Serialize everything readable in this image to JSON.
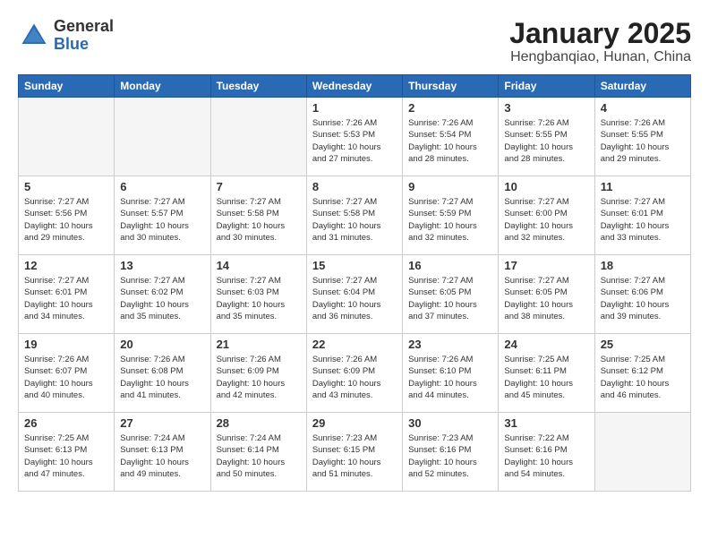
{
  "header": {
    "logo_general": "General",
    "logo_blue": "Blue",
    "title": "January 2025",
    "subtitle": "Hengbanqiao, Hunan, China"
  },
  "weekdays": [
    "Sunday",
    "Monday",
    "Tuesday",
    "Wednesday",
    "Thursday",
    "Friday",
    "Saturday"
  ],
  "weeks": [
    [
      {
        "day": "",
        "empty": true
      },
      {
        "day": "",
        "empty": true
      },
      {
        "day": "",
        "empty": true
      },
      {
        "day": "1",
        "sunrise": "Sunrise: 7:26 AM",
        "sunset": "Sunset: 5:53 PM",
        "daylight": "Daylight: 10 hours and 27 minutes."
      },
      {
        "day": "2",
        "sunrise": "Sunrise: 7:26 AM",
        "sunset": "Sunset: 5:54 PM",
        "daylight": "Daylight: 10 hours and 28 minutes."
      },
      {
        "day": "3",
        "sunrise": "Sunrise: 7:26 AM",
        "sunset": "Sunset: 5:55 PM",
        "daylight": "Daylight: 10 hours and 28 minutes."
      },
      {
        "day": "4",
        "sunrise": "Sunrise: 7:26 AM",
        "sunset": "Sunset: 5:55 PM",
        "daylight": "Daylight: 10 hours and 29 minutes."
      }
    ],
    [
      {
        "day": "5",
        "sunrise": "Sunrise: 7:27 AM",
        "sunset": "Sunset: 5:56 PM",
        "daylight": "Daylight: 10 hours and 29 minutes."
      },
      {
        "day": "6",
        "sunrise": "Sunrise: 7:27 AM",
        "sunset": "Sunset: 5:57 PM",
        "daylight": "Daylight: 10 hours and 30 minutes."
      },
      {
        "day": "7",
        "sunrise": "Sunrise: 7:27 AM",
        "sunset": "Sunset: 5:58 PM",
        "daylight": "Daylight: 10 hours and 30 minutes."
      },
      {
        "day": "8",
        "sunrise": "Sunrise: 7:27 AM",
        "sunset": "Sunset: 5:58 PM",
        "daylight": "Daylight: 10 hours and 31 minutes."
      },
      {
        "day": "9",
        "sunrise": "Sunrise: 7:27 AM",
        "sunset": "Sunset: 5:59 PM",
        "daylight": "Daylight: 10 hours and 32 minutes."
      },
      {
        "day": "10",
        "sunrise": "Sunrise: 7:27 AM",
        "sunset": "Sunset: 6:00 PM",
        "daylight": "Daylight: 10 hours and 32 minutes."
      },
      {
        "day": "11",
        "sunrise": "Sunrise: 7:27 AM",
        "sunset": "Sunset: 6:01 PM",
        "daylight": "Daylight: 10 hours and 33 minutes."
      }
    ],
    [
      {
        "day": "12",
        "sunrise": "Sunrise: 7:27 AM",
        "sunset": "Sunset: 6:01 PM",
        "daylight": "Daylight: 10 hours and 34 minutes."
      },
      {
        "day": "13",
        "sunrise": "Sunrise: 7:27 AM",
        "sunset": "Sunset: 6:02 PM",
        "daylight": "Daylight: 10 hours and 35 minutes."
      },
      {
        "day": "14",
        "sunrise": "Sunrise: 7:27 AM",
        "sunset": "Sunset: 6:03 PM",
        "daylight": "Daylight: 10 hours and 35 minutes."
      },
      {
        "day": "15",
        "sunrise": "Sunrise: 7:27 AM",
        "sunset": "Sunset: 6:04 PM",
        "daylight": "Daylight: 10 hours and 36 minutes."
      },
      {
        "day": "16",
        "sunrise": "Sunrise: 7:27 AM",
        "sunset": "Sunset: 6:05 PM",
        "daylight": "Daylight: 10 hours and 37 minutes."
      },
      {
        "day": "17",
        "sunrise": "Sunrise: 7:27 AM",
        "sunset": "Sunset: 6:05 PM",
        "daylight": "Daylight: 10 hours and 38 minutes."
      },
      {
        "day": "18",
        "sunrise": "Sunrise: 7:27 AM",
        "sunset": "Sunset: 6:06 PM",
        "daylight": "Daylight: 10 hours and 39 minutes."
      }
    ],
    [
      {
        "day": "19",
        "sunrise": "Sunrise: 7:26 AM",
        "sunset": "Sunset: 6:07 PM",
        "daylight": "Daylight: 10 hours and 40 minutes."
      },
      {
        "day": "20",
        "sunrise": "Sunrise: 7:26 AM",
        "sunset": "Sunset: 6:08 PM",
        "daylight": "Daylight: 10 hours and 41 minutes."
      },
      {
        "day": "21",
        "sunrise": "Sunrise: 7:26 AM",
        "sunset": "Sunset: 6:09 PM",
        "daylight": "Daylight: 10 hours and 42 minutes."
      },
      {
        "day": "22",
        "sunrise": "Sunrise: 7:26 AM",
        "sunset": "Sunset: 6:09 PM",
        "daylight": "Daylight: 10 hours and 43 minutes."
      },
      {
        "day": "23",
        "sunrise": "Sunrise: 7:26 AM",
        "sunset": "Sunset: 6:10 PM",
        "daylight": "Daylight: 10 hours and 44 minutes."
      },
      {
        "day": "24",
        "sunrise": "Sunrise: 7:25 AM",
        "sunset": "Sunset: 6:11 PM",
        "daylight": "Daylight: 10 hours and 45 minutes."
      },
      {
        "day": "25",
        "sunrise": "Sunrise: 7:25 AM",
        "sunset": "Sunset: 6:12 PM",
        "daylight": "Daylight: 10 hours and 46 minutes."
      }
    ],
    [
      {
        "day": "26",
        "sunrise": "Sunrise: 7:25 AM",
        "sunset": "Sunset: 6:13 PM",
        "daylight": "Daylight: 10 hours and 47 minutes."
      },
      {
        "day": "27",
        "sunrise": "Sunrise: 7:24 AM",
        "sunset": "Sunset: 6:13 PM",
        "daylight": "Daylight: 10 hours and 49 minutes."
      },
      {
        "day": "28",
        "sunrise": "Sunrise: 7:24 AM",
        "sunset": "Sunset: 6:14 PM",
        "daylight": "Daylight: 10 hours and 50 minutes."
      },
      {
        "day": "29",
        "sunrise": "Sunrise: 7:23 AM",
        "sunset": "Sunset: 6:15 PM",
        "daylight": "Daylight: 10 hours and 51 minutes."
      },
      {
        "day": "30",
        "sunrise": "Sunrise: 7:23 AM",
        "sunset": "Sunset: 6:16 PM",
        "daylight": "Daylight: 10 hours and 52 minutes."
      },
      {
        "day": "31",
        "sunrise": "Sunrise: 7:22 AM",
        "sunset": "Sunset: 6:16 PM",
        "daylight": "Daylight: 10 hours and 54 minutes."
      },
      {
        "day": "",
        "empty": true
      }
    ]
  ]
}
